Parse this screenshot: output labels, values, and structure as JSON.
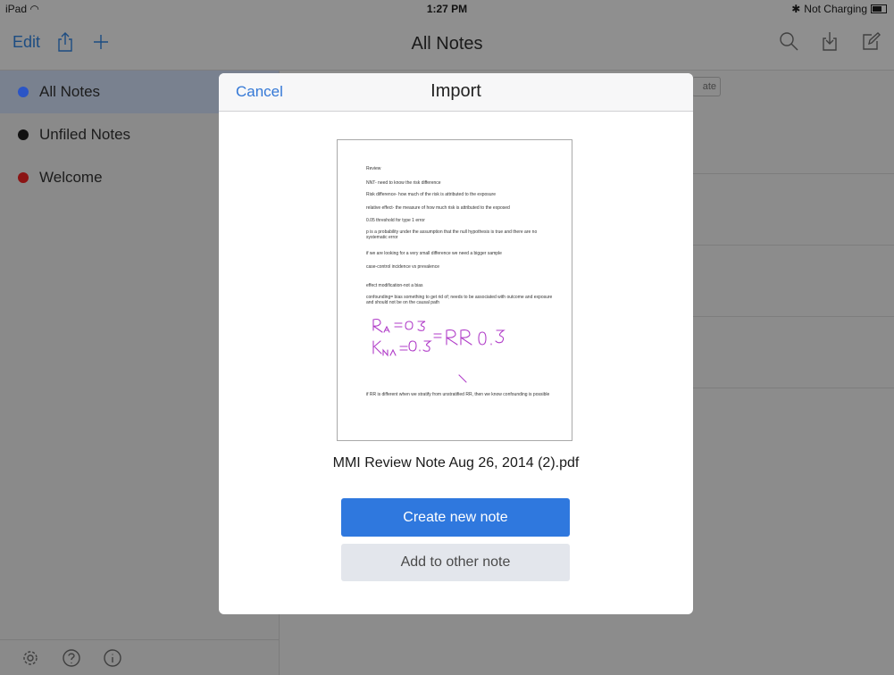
{
  "status": {
    "device": "iPad",
    "time": "1:27 PM",
    "charging": "Not Charging"
  },
  "nav": {
    "edit_label": "Edit",
    "title": "All Notes"
  },
  "sidebar": {
    "items": [
      {
        "label": "All Notes",
        "color": "#2b55c6"
      },
      {
        "label": "Unfiled Notes",
        "color": "#111111"
      },
      {
        "label": "Welcome",
        "color": "#8b1414"
      }
    ]
  },
  "background_button": "ate",
  "modal": {
    "cancel_label": "Cancel",
    "title": "Import",
    "filename": "MMI Review Note Aug 26, 2014 (2).pdf",
    "primary_label": "Create new note",
    "secondary_label": "Add to other note",
    "pdf_lines": [
      "Review",
      "NNT- need to know the risk difference",
      "Risk difference- how much of the risk is attributed to the exposure",
      "relative effect- the measure of how much risk is attributed to the exposed",
      "0.05 threshold for type 1 error",
      "p is a probability under the assumption that the null hypothesis is true and there are no systematic error",
      "if we are looking for a very small difference we need a bigger sample",
      "case-control incidence vs prevalence",
      "effect modification-not a bias",
      "confounding= bias something to get rid of; needs to be associated with outcome and exposure and should not be on the causal path",
      "if RR is different when we stratify from unstratified RR, then we know confounding is possible"
    ]
  }
}
